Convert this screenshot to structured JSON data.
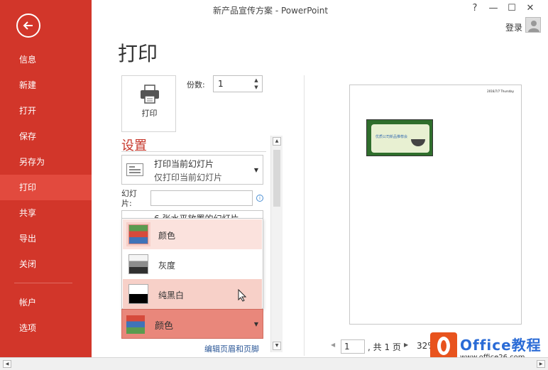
{
  "window": {
    "title": "新产品宣传方案 - PowerPoint",
    "help": "?",
    "minimize": "—",
    "restore": "☐",
    "close": "✕",
    "login": "登录"
  },
  "sidebar": {
    "items": [
      {
        "label": "信息"
      },
      {
        "label": "新建"
      },
      {
        "label": "打开"
      },
      {
        "label": "保存"
      },
      {
        "label": "另存为"
      },
      {
        "label": "打印"
      },
      {
        "label": "共享"
      },
      {
        "label": "导出"
      },
      {
        "label": "关闭"
      }
    ],
    "bottom_items": [
      {
        "label": "帐户"
      },
      {
        "label": "选项"
      }
    ],
    "active": "打印",
    "color": "#d2362a"
  },
  "print": {
    "title": "打印",
    "button_label": "打印",
    "copies_label": "份数:",
    "copies_value": "1"
  },
  "settings": {
    "title": "设置",
    "slide_range_main": "打印当前幻灯片",
    "slide_range_sub": "仅打印当前幻灯片",
    "slides_label": "幻灯片:",
    "slides_value": "",
    "layout_partial": "6 张水平放置的幻灯片",
    "color_options": [
      {
        "label": "颜色",
        "state": "selected"
      },
      {
        "label": "灰度",
        "state": "normal"
      },
      {
        "label": "纯黑白",
        "state": "hover"
      }
    ],
    "color_selected": "颜色",
    "header_footer_link": "编辑页眉和页脚"
  },
  "preview": {
    "date_text": "2016/7/7 Thursday",
    "slide_caption": "优质公司新品推荐会",
    "page_value": "1",
    "page_total": ", 共 1 页",
    "zoom": "32%"
  },
  "watermark": {
    "text": "Office教程网",
    "url": "www.office26.com"
  }
}
